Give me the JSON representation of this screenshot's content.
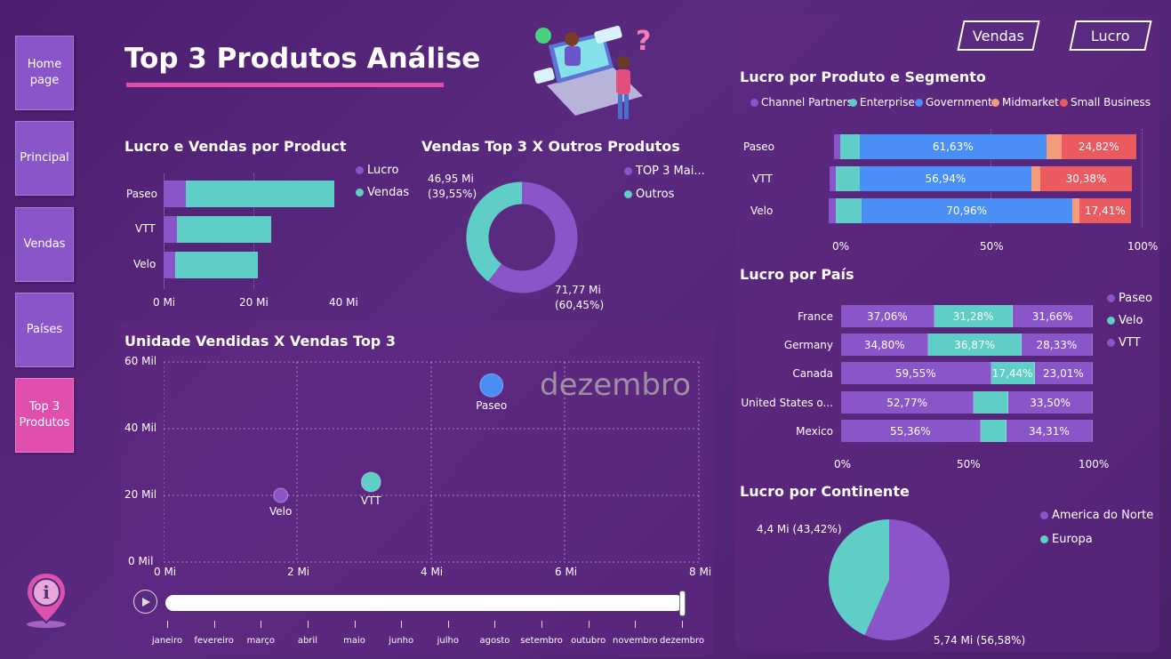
{
  "nav": {
    "items": [
      "Home page",
      "Principal",
      "Vendas",
      "Países",
      "Top 3 Produtos"
    ]
  },
  "header": {
    "title": "Top 3 Produtos Análise"
  },
  "top_buttons": {
    "vendas": "Vendas",
    "lucro": "Lucro"
  },
  "colors": {
    "purple": "#8a55c8",
    "teal": "#5ecec6",
    "blue": "#4a8ff5",
    "salmon": "#f39b7a",
    "red": "#ea5a5f",
    "pink": "#e04fae"
  },
  "chart_lucro_vendas": {
    "title": "Lucro e Vendas por Product",
    "legend": [
      "Lucro",
      "Vendas"
    ],
    "categories": [
      "Paseo",
      "VTT",
      "Velo"
    ],
    "x_ticks": [
      "0 Mi",
      "20 Mi",
      "40 Mi"
    ]
  },
  "chart_donut": {
    "title": "Vendas Top 3 X Outros Produtos",
    "legend": [
      "TOP 3 Mai...",
      "Outros"
    ],
    "label_outros_value": "46,95 Mi",
    "label_outros_pct": "(39,55%)",
    "label_top3_value": "71,77 Mi",
    "label_top3_pct": "(60,45%)"
  },
  "chart_scatter": {
    "title": "Unidade Vendidas X Vendas Top 3",
    "y_ticks": [
      "60 Mil",
      "40 Mil",
      "20 Mil",
      "0 Mil"
    ],
    "x_ticks": [
      "0 Mi",
      "2 Mi",
      "4 Mi",
      "6 Mi",
      "8 Mi"
    ],
    "watermark": "dezembro",
    "point_labels": [
      "Paseo",
      "Velo",
      "VTT"
    ],
    "months": [
      "janeiro",
      "fevereiro",
      "março",
      "abril",
      "maio",
      "junho",
      "julho",
      "agosto",
      "setembro",
      "outubro",
      "novembro",
      "dezembro"
    ]
  },
  "chart_segmento": {
    "title": "Lucro por Produto e Segmento",
    "legend": [
      "Channel Partners",
      "Enterprise",
      "Government",
      "Midmarket",
      "Small Business"
    ],
    "rows": [
      "Paseo",
      "VTT",
      "Velo"
    ],
    "labels": [
      [
        "61,63%",
        "24,82%"
      ],
      [
        "56,94%",
        "30,38%"
      ],
      [
        "70,96%",
        "17,41%"
      ]
    ],
    "x_ticks": [
      "0%",
      "50%",
      "100%"
    ]
  },
  "chart_pais": {
    "title": "Lucro por País",
    "legend": [
      "Paseo",
      "Velo",
      "VTT"
    ],
    "rows": [
      "France",
      "Germany",
      "Canada",
      "United States o...",
      "Mexico"
    ],
    "labels": [
      [
        "37,06%",
        "31,28%",
        "31,66%"
      ],
      [
        "34,80%",
        "36,87%",
        "28,33%"
      ],
      [
        "59,55%",
        "17,44%",
        "23,01%"
      ],
      [
        "52,77%",
        "",
        "33,50%"
      ],
      [
        "55,36%",
        "",
        "34,31%"
      ]
    ],
    "x_ticks": [
      "0%",
      "50%",
      "100%"
    ]
  },
  "chart_continente": {
    "title": "Lucro por Continente",
    "legend": [
      "America do Norte",
      "Europa"
    ],
    "label_europa": "4,4 Mi (43,42%)",
    "label_america": "5,74 Mi (56,58%)"
  },
  "chart_data": [
    {
      "type": "bar",
      "title": "Lucro e Vendas por Product",
      "categories": [
        "Paseo",
        "VTT",
        "Velo"
      ],
      "series": [
        {
          "name": "Lucro",
          "values": [
            5,
            3,
            2.5
          ]
        },
        {
          "name": "Vendas",
          "values": [
            38,
            24,
            21
          ]
        }
      ],
      "xlim": [
        0,
        40
      ]
    },
    {
      "type": "pie",
      "title": "Vendas Top 3 X Outros Produtos",
      "categories": [
        "TOP 3 Mai...",
        "Outros"
      ],
      "values": [
        71.77,
        46.95
      ]
    },
    {
      "type": "scatter",
      "title": "Unidade Vendidas X Vendas Top 3",
      "points": [
        {
          "name": "Paseo",
          "x": 4.9,
          "y": 53
        },
        {
          "name": "Velo",
          "x": 1.75,
          "y": 20
        },
        {
          "name": "VTT",
          "x": 3.1,
          "y": 24
        }
      ],
      "xlim": [
        0,
        8
      ],
      "ylim": [
        0,
        60
      ]
    },
    {
      "type": "bar",
      "title": "Lucro por Produto e Segmento",
      "categories": [
        "Paseo",
        "VTT",
        "Velo"
      ],
      "series": [
        {
          "name": "Channel Partners",
          "values": [
            2,
            2,
            2.5
          ]
        },
        {
          "name": "Enterprise",
          "values": [
            6.5,
            8,
            8.5
          ]
        },
        {
          "name": "Government",
          "values": [
            61.63,
            56.94,
            70.96
          ]
        },
        {
          "name": "Midmarket",
          "values": [
            5,
            3,
            2.5
          ]
        },
        {
          "name": "Small Business",
          "values": [
            24.82,
            30.38,
            17.41
          ]
        }
      ]
    },
    {
      "type": "bar",
      "title": "Lucro por País",
      "categories": [
        "France",
        "Germany",
        "Canada",
        "United States o...",
        "Mexico"
      ],
      "series": [
        {
          "name": "Paseo",
          "values": [
            37.06,
            34.8,
            59.55,
            52.77,
            55.36
          ]
        },
        {
          "name": "Velo",
          "values": [
            31.28,
            36.87,
            17.44,
            13.73,
            10.33
          ]
        },
        {
          "name": "VTT",
          "values": [
            31.66,
            28.33,
            23.01,
            33.5,
            34.31
          ]
        }
      ]
    },
    {
      "type": "pie",
      "title": "Lucro por Continente",
      "categories": [
        "America do Norte",
        "Europa"
      ],
      "values": [
        5.74,
        4.4
      ]
    }
  ]
}
